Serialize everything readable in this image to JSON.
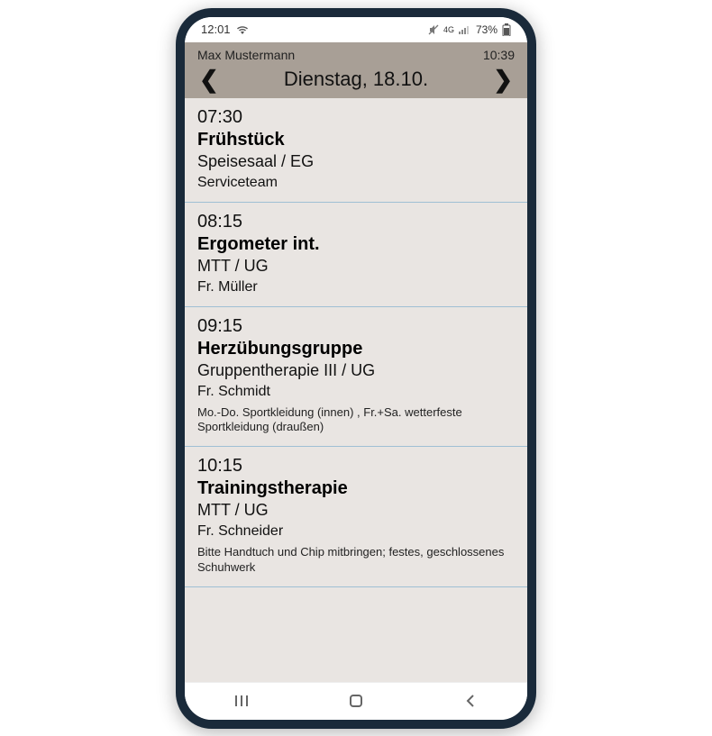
{
  "status": {
    "time": "12:01",
    "network": "4G",
    "battery": "73%"
  },
  "header": {
    "user": "Max Mustermann",
    "clock": "10:39",
    "date": "Dienstag, 18.10."
  },
  "schedule": [
    {
      "time": "07:30",
      "title": "Frühstück",
      "location": "Speisesaal / EG",
      "instructor": "Serviceteam",
      "note": ""
    },
    {
      "time": "08:15",
      "title": "Ergometer int.",
      "location": "MTT / UG",
      "instructor": "Fr. Müller",
      "note": ""
    },
    {
      "time": "09:15",
      "title": "Herzübungsgruppe",
      "location": "Gruppentherapie III / UG",
      "instructor": "Fr. Schmidt",
      "note": "Mo.-Do. Sportkleidung (innen) , Fr.+Sa. wetterfeste Sportkleidung (draußen)"
    },
    {
      "time": "10:15",
      "title": "Trainingstherapie",
      "location": "MTT / UG",
      "instructor": "Fr. Schneider",
      "note": "Bitte Handtuch und Chip mitbringen; festes, geschlossenes Schuhwerk"
    }
  ]
}
